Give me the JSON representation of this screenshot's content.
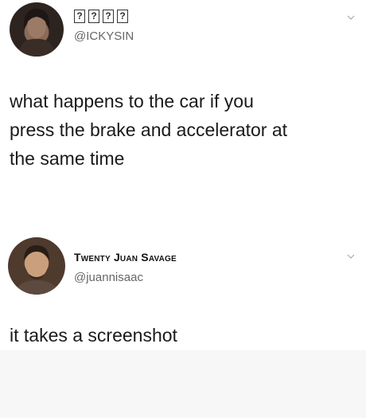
{
  "tweets": [
    {
      "display_name_glyphs": [
        "?",
        "?",
        "?",
        "?"
      ],
      "handle": "@ICKYSIN",
      "text_lines": [
        "what happens to the car if you",
        "press the brake and accelerator at",
        "the same time"
      ]
    },
    {
      "display_name": "Twenty Juan Savage",
      "handle": "@juannisaac",
      "text_lines": [
        "it takes a screenshot"
      ]
    }
  ]
}
